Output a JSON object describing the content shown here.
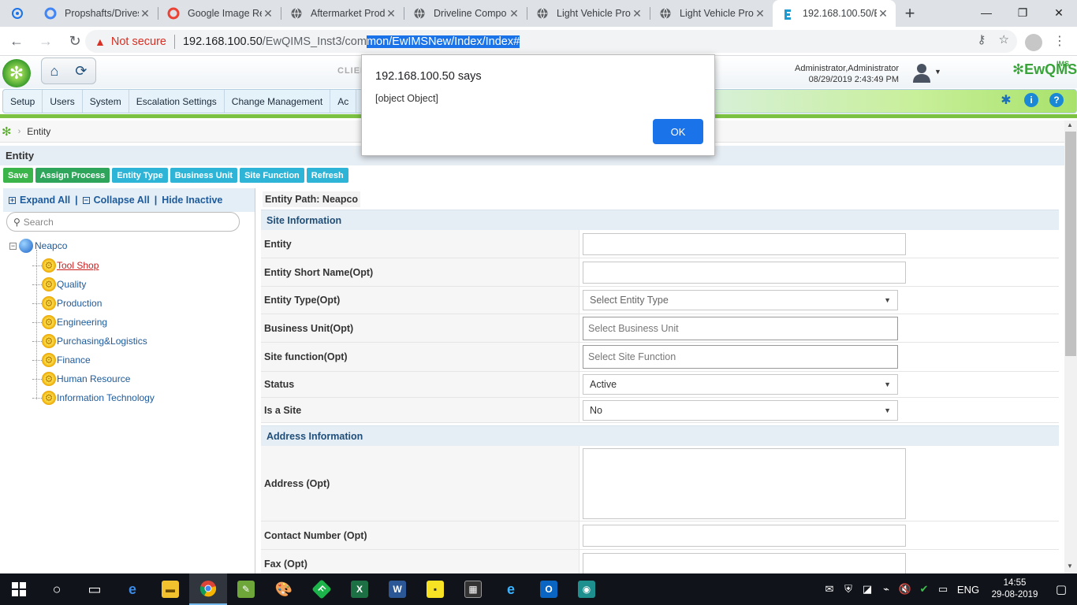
{
  "browser": {
    "tabs": [
      {
        "title": "Propshafts/Drives",
        "icon": "google-icon"
      },
      {
        "title": "Google Image Re",
        "icon": "google-icon"
      },
      {
        "title": "Aftermarket Prod",
        "icon": "globe-icon"
      },
      {
        "title": "Driveline Compo",
        "icon": "globe-icon"
      },
      {
        "title": "Light Vehicle Prod",
        "icon": "globe-icon"
      },
      {
        "title": "Light Vehicle Prod",
        "icon": "globe-icon"
      },
      {
        "title": "192.168.100.50/E",
        "icon": "ewqims-icon"
      }
    ],
    "not_secure": "Not secure",
    "url_host": "192.168.100.50",
    "url_path_plain": "/EwQIMS_Inst3/com",
    "url_path_selected": "mon/EwIMSNew/Index/Index#",
    "new_tab": "+"
  },
  "header": {
    "client_logo_text": "CLIEN",
    "user_name": "Administrator,Administrator",
    "datetime": "08/29/2019 2:43:49 PM",
    "brand": "EwQMS",
    "brand_small": "IMS"
  },
  "menu": {
    "items": [
      "Setup",
      "Users",
      "System",
      "Escalation Settings",
      "Change Management",
      "Ac"
    ]
  },
  "breadcrumb": {
    "current": "Entity"
  },
  "page": {
    "title": "Entity"
  },
  "actions": {
    "save": "Save",
    "assign_process": "Assign Process",
    "entity_type": "Entity Type",
    "business_unit": "Business Unit",
    "site_function": "Site Function",
    "refresh": "Refresh"
  },
  "tree": {
    "expand_all": "Expand All",
    "collapse_all": "Collapse All",
    "hide_inactive": "Hide Inactive",
    "search_placeholder": "Search",
    "root": "Neapco",
    "children": [
      "Tool Shop",
      "Quality",
      "Production",
      "Engineering",
      "Purchasing&Logistics",
      "Finance",
      "Human Resource",
      "Information Technology"
    ]
  },
  "form": {
    "entity_path": "Entity Path: Neapco",
    "site_info_title": "Site Information",
    "entity_label": "Entity",
    "short_name_label": "Entity Short Name(Opt)",
    "entity_type_label": "Entity Type(Opt)",
    "entity_type_placeholder": "Select Entity Type",
    "business_unit_label": "Business Unit(Opt)",
    "business_unit_placeholder": "Select Business Unit",
    "site_function_label": "Site function(Opt)",
    "site_function_placeholder": "Select Site Function",
    "status_label": "Status",
    "status_value": "Active",
    "is_site_label": "Is a Site",
    "is_site_value": "No",
    "address_info_title": "Address Information",
    "address_label": "Address (Opt)",
    "contact_label": "Contact Number (Opt)",
    "fax_label": "Fax (Opt)"
  },
  "dialog": {
    "title": "192.168.100.50 says",
    "message": "[object Object]",
    "ok": "OK"
  },
  "taskbar": {
    "lang": "ENG",
    "time": "14:55",
    "date": "29-08-2019"
  }
}
